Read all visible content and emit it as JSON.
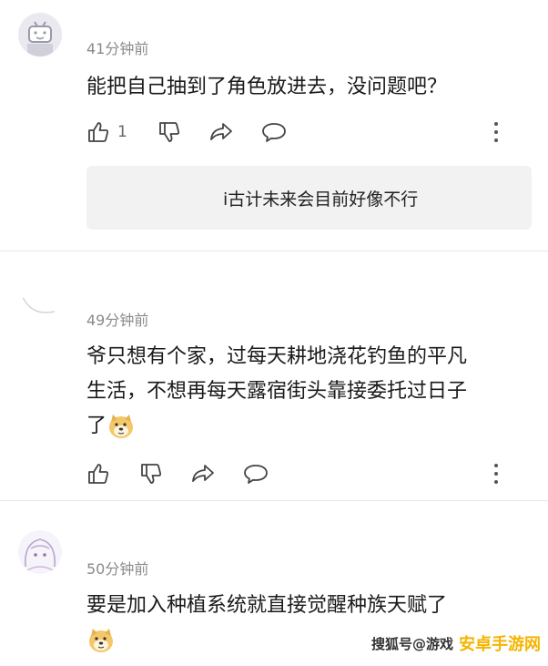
{
  "comments": [
    {
      "time": "41分钟前",
      "text": "能把自己抽到了角色放进去，没问题吧？",
      "like_count": "1",
      "reply": "i古计未来会目前好像不行"
    },
    {
      "time": "49分钟前",
      "lines": [
        "爷只想有个家，过每天耕地浇花钓鱼的平凡",
        "生活，不想再每天露宿街头靠接委托过日子",
        "了"
      ]
    },
    {
      "time": "50分钟前",
      "text": "要是加入种植系统就直接觉醒种族天赋了"
    }
  ],
  "watermark": {
    "left": "搜狐号@游戏",
    "right": "安卓手游网"
  },
  "icons": [
    "tv-avatar-icon",
    "thumbs-up-icon",
    "thumbs-down-icon",
    "share-icon",
    "comment-icon",
    "more-vertical-icon",
    "doge-emoji-icon"
  ]
}
